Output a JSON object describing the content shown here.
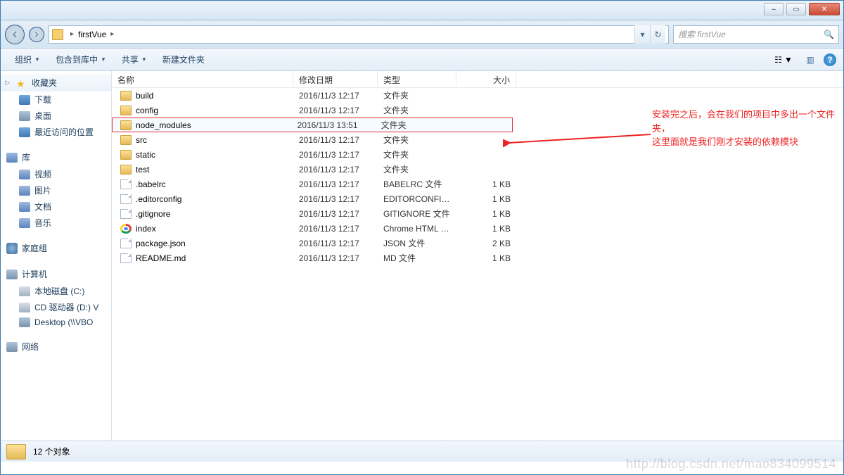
{
  "window": {
    "min": "–",
    "max": "▭",
    "close": "✕"
  },
  "address": {
    "folder": "firstVue",
    "sep": "▸",
    "search_placeholder": "搜索 firstVue"
  },
  "toolbar": {
    "organize": "组织",
    "include": "包含到库中",
    "share": "共享",
    "newfolder": "新建文件夹"
  },
  "columns": {
    "name": "名称",
    "date": "修改日期",
    "type": "类型",
    "size": "大小"
  },
  "sidebar": {
    "favorites": "收藏夹",
    "fav_items": [
      "下载",
      "桌面",
      "最近访问的位置"
    ],
    "library": "库",
    "lib_items": [
      "视频",
      "图片",
      "文档",
      "音乐"
    ],
    "homegroup": "家庭组",
    "computer": "计算机",
    "comp_items": [
      "本地磁盘 (C:)",
      "CD 驱动器 (D:) V",
      "Desktop (\\\\VBO"
    ],
    "network": "网络"
  },
  "files": [
    {
      "name": "build",
      "date": "2016/11/3 12:17",
      "type": "文件夹",
      "size": "",
      "icon": "folder",
      "hl": false
    },
    {
      "name": "config",
      "date": "2016/11/3 12:17",
      "type": "文件夹",
      "size": "",
      "icon": "folder",
      "hl": false
    },
    {
      "name": "node_modules",
      "date": "2016/11/3 13:51",
      "type": "文件夹",
      "size": "",
      "icon": "folder",
      "hl": true
    },
    {
      "name": "src",
      "date": "2016/11/3 12:17",
      "type": "文件夹",
      "size": "",
      "icon": "folder",
      "hl": false
    },
    {
      "name": "static",
      "date": "2016/11/3 12:17",
      "type": "文件夹",
      "size": "",
      "icon": "folder",
      "hl": false
    },
    {
      "name": "test",
      "date": "2016/11/3 12:17",
      "type": "文件夹",
      "size": "",
      "icon": "folder",
      "hl": false
    },
    {
      "name": ".babelrc",
      "date": "2016/11/3 12:17",
      "type": "BABELRC 文件",
      "size": "1 KB",
      "icon": "file",
      "hl": false
    },
    {
      "name": ".editorconfig",
      "date": "2016/11/3 12:17",
      "type": "EDITORCONFIG ...",
      "size": "1 KB",
      "icon": "file",
      "hl": false
    },
    {
      "name": ".gitignore",
      "date": "2016/11/3 12:17",
      "type": "GITIGNORE 文件",
      "size": "1 KB",
      "icon": "file",
      "hl": false
    },
    {
      "name": "index",
      "date": "2016/11/3 12:17",
      "type": "Chrome HTML D...",
      "size": "1 KB",
      "icon": "chrome",
      "hl": false
    },
    {
      "name": "package.json",
      "date": "2016/11/3 12:17",
      "type": "JSON 文件",
      "size": "2 KB",
      "icon": "file",
      "hl": false
    },
    {
      "name": "README.md",
      "date": "2016/11/3 12:17",
      "type": "MD 文件",
      "size": "1 KB",
      "icon": "file",
      "hl": false
    }
  ],
  "annotation": {
    "line1": "安装完之后，会在我们的项目中多出一个文件夹，",
    "line2": "这里面就是我们刚才安装的依赖模块"
  },
  "status": {
    "count": "12 个对象"
  },
  "watermark": "http://blog.csdn.net/mao834099514"
}
